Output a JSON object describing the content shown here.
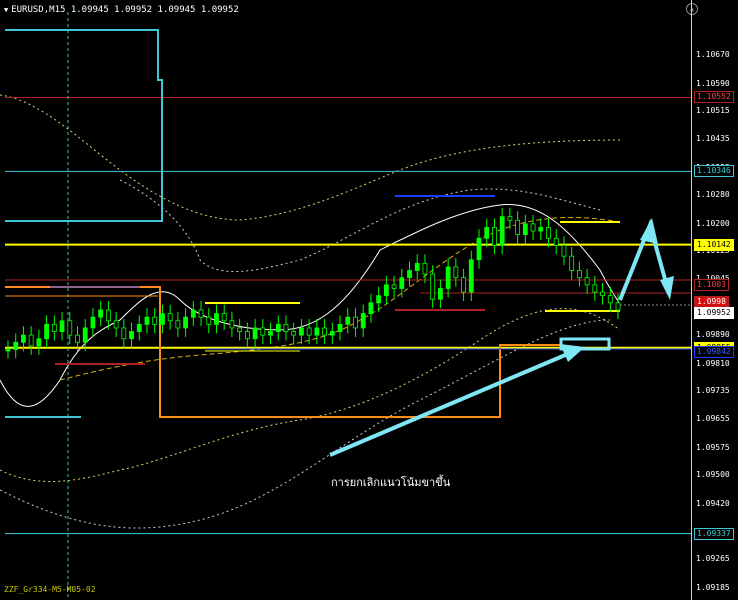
{
  "header": {
    "symbol_info": "EURUSD,M15  1.09945 1.09952 1.09945 1.09952"
  },
  "annotation": {
    "text": "การยกเลิกแนวโน้มขาขึ้น"
  },
  "indicator_label": "ZZF_Gr334-M5-M05-02",
  "colors": {
    "background": "#000000",
    "candle": "#00ff00",
    "yellow_line": "#ffff00",
    "cyan_line": "#3fc7d6",
    "red_line": "#b02020",
    "orange_line": "#ff8c1a",
    "blue_line": "#1e3cff",
    "arrow": "#7ee6f5"
  },
  "chart_data": {
    "type": "line",
    "symbol": "EURUSD",
    "timeframe": "M15",
    "ohlc_header": {
      "open": 1.09945,
      "high": 1.09952,
      "low": 1.09945,
      "close": 1.09952
    },
    "ylim": [
      1.0918,
      1.1074
    ],
    "y_ticks": [
      "1.10670",
      "1.10590",
      "1.10515",
      "1.10435",
      "1.10355",
      "1.10280",
      "1.10200",
      "1.10125",
      "1.10045",
      "1.09970",
      "1.09890",
      "1.09810",
      "1.09735",
      "1.09655",
      "1.09575",
      "1.09500",
      "1.09420",
      "1.09340",
      "1.09265",
      "1.09185"
    ],
    "price_tags": [
      {
        "value": 1.10552,
        "label": "1.10552",
        "color": "#b02020",
        "text_color": "#ff4040",
        "bg": "#000000"
      },
      {
        "value": 1.10346,
        "label": "1.10346",
        "color": "#3fc7d6",
        "text_color": "#3fc7d6",
        "bg": "#000000"
      },
      {
        "value": 1.10142,
        "label": "1.10142",
        "color": "#ffff00",
        "text_color": "#000000",
        "bg": "#ffff00"
      },
      {
        "value": 1.1003,
        "label": "1.1003",
        "color": "#b02020",
        "text_color": "#ff4040",
        "bg": "#000000"
      },
      {
        "value": 1.09982,
        "label": "1.0998",
        "color": "#b02020",
        "text_color": "#ffffff",
        "bg": "#d01010"
      },
      {
        "value": 1.09952,
        "label": "1.09952",
        "color": "#ffffff",
        "text_color": "#000000",
        "bg": "#ffffff"
      },
      {
        "value": 1.09855,
        "label": "1.09855",
        "color": "#ffff00",
        "text_color": "#000000",
        "bg": "#ffff00"
      },
      {
        "value": 1.09842,
        "label": "1.09842",
        "color": "#1e3cff",
        "text_color": "#3a5cff",
        "bg": "#000000"
      },
      {
        "value": 1.09337,
        "label": "1.09337",
        "color": "#3fc7d6",
        "text_color": "#3fc7d6",
        "bg": "#000000"
      }
    ],
    "horizontal_levels": [
      {
        "value": 1.10552,
        "color": "#b02020"
      },
      {
        "value": 1.10346,
        "color": "#3fc7d6"
      },
      {
        "value": 1.10142,
        "color": "#ffff00"
      },
      {
        "value": 1.09855,
        "color": "#ffff00"
      },
      {
        "value": 1.09337,
        "color": "#3fc7d6"
      }
    ],
    "close_series": [
      1.0985,
      1.0987,
      1.0989,
      1.0986,
      1.0988,
      1.0992,
      1.099,
      1.0993,
      1.0989,
      1.0987,
      1.0991,
      1.0994,
      1.0996,
      1.0993,
      1.0991,
      1.0988,
      1.099,
      1.0992,
      1.0994,
      1.0992,
      1.0995,
      1.0993,
      1.0991,
      1.0994,
      1.0996,
      1.0994,
      1.0992,
      1.0995,
      1.0993,
      1.0991,
      1.099,
      1.0988,
      1.0991,
      1.0989,
      1.099,
      1.0992,
      1.099,
      1.0989,
      1.0991,
      1.0989,
      1.0991,
      1.0989,
      1.099,
      1.0992,
      1.0994,
      1.0991,
      1.0995,
      1.0998,
      1.1,
      1.1003,
      1.1002,
      1.1005,
      1.1007,
      1.1009,
      1.1006,
      1.0999,
      1.1002,
      1.1008,
      1.1005,
      1.1001,
      1.101,
      1.1016,
      1.1019,
      1.1014,
      1.1022,
      1.1021,
      1.1017,
      1.102,
      1.1018,
      1.1019,
      1.1016,
      1.1014,
      1.1011,
      1.1007,
      1.1005,
      1.1003,
      1.1001,
      1.1,
      1.0998,
      1.0996
    ]
  }
}
